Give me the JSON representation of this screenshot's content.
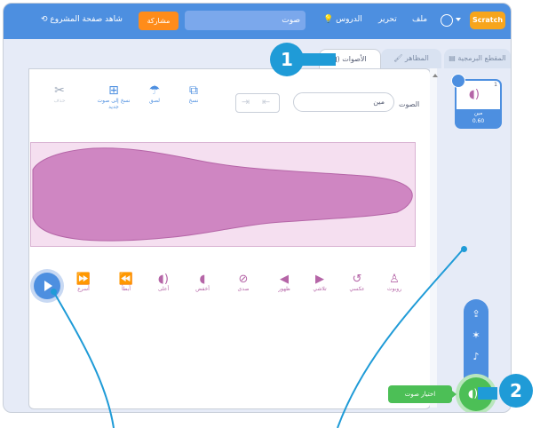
{
  "menubar": {
    "logo": "Scratch",
    "file": "ملف",
    "edit": "تحرير",
    "tutorials": "الدروس",
    "project_title": "صوت",
    "share": "مشاركة",
    "see_project": "شاهد صفحة المشروع"
  },
  "tabs": {
    "code": "المقطع البرمجية",
    "costumes": "المظاهر",
    "sounds": "الأصوات"
  },
  "sound_list": {
    "items": [
      {
        "index": "1",
        "name": "مين",
        "duration": "0.60"
      }
    ]
  },
  "editor": {
    "sound_label": "الصوت",
    "sound_name": "مين",
    "buttons": {
      "copy": "نسخ",
      "paste": "لصق",
      "copy_to_new": "نسخ إلى صوت جديد",
      "delete": "حذف"
    },
    "effects": {
      "faster": "أسرع",
      "slower": "أبطأ",
      "echo": "صدى",
      "robot": "روبوت",
      "louder": "أعلى",
      "softer": "أخفض",
      "reverse": "عكسي",
      "fade_in": "ظهور",
      "fade_out": "تلاشي"
    }
  },
  "choose_sound": {
    "tooltip": "اختيار صوت"
  },
  "callouts": {
    "one": "1",
    "two": "2"
  },
  "colors": {
    "menubar": "#4d8fe0",
    "accent_orange": "#ff8c1a",
    "waveform": "#cf86c2",
    "callout": "#1f9bd7",
    "choose_green": "#4cbf56"
  }
}
